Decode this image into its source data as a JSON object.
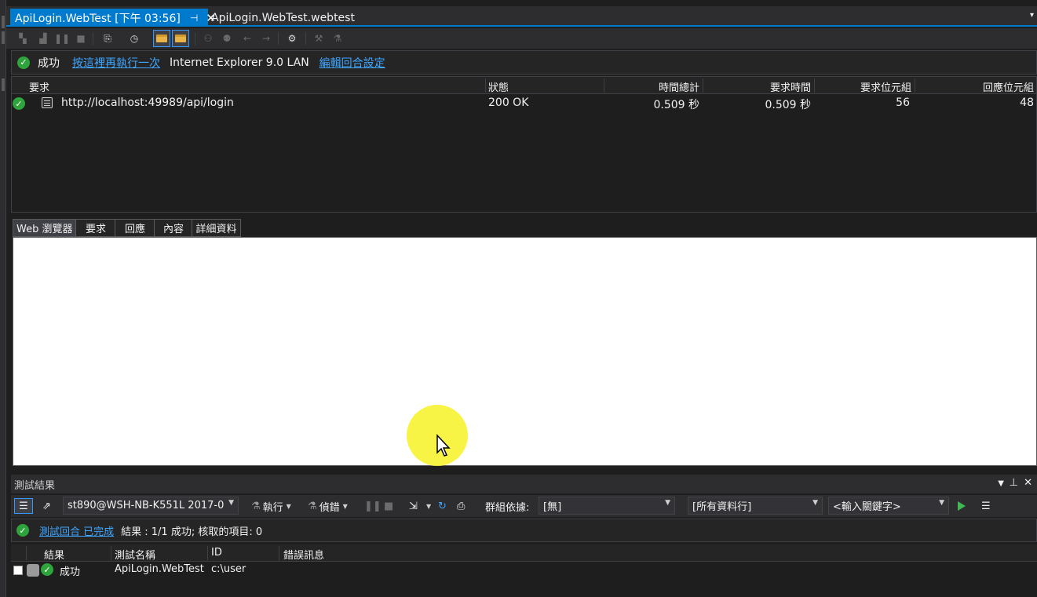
{
  "tabs": {
    "active_label": "ApiLogin.WebTest [下午 03:56]",
    "pin_glyph": "⊣",
    "close_glyph": "✕",
    "second_label": "ApiLogin.WebTest.webtest",
    "overflow_glyph": "▾"
  },
  "status": {
    "result": "成功",
    "rerun_link": "按這裡再執行一次",
    "browser": "Internet Explorer 9.0  LAN",
    "edit_link": "編輯回合設定"
  },
  "requests": {
    "columns": [
      "要求",
      "狀態",
      "時間總計",
      "要求時間",
      "要求位元組",
      "回應位元組"
    ],
    "rows": [
      {
        "url": "http://localhost:49989/api/login",
        "status": "200 OK",
        "total_time": "0.509 秒",
        "request_time": "0.509 秒",
        "request_bytes": "56",
        "response_bytes": "48"
      }
    ]
  },
  "detail_tabs": [
    "Web 瀏覽器",
    "要求",
    "回應",
    "內容",
    "詳細資料"
  ],
  "test_results": {
    "title": "測試結果",
    "run_combo": "st890@WSH-NB-K551L 2017-0",
    "run_label": "執行",
    "debug_label": "偵錯",
    "group_by_label": "群組依據:",
    "group_by_value": "[無]",
    "filter_columns": "[所有資料行]",
    "keyword_placeholder": "<輸入關鍵字>",
    "status_link": "測試回合 已完成",
    "status_summary": "結果 : 1/1 成功;  核取的項目: 0",
    "columns": [
      "結果",
      "測試名稱",
      "ID",
      "錯誤訊息"
    ],
    "rows": [
      {
        "result": "成功",
        "name": "ApiLogin.WebTest",
        "id": "c:\\user"
      }
    ]
  },
  "colors": {
    "accent": "#007acc",
    "success": "#2fa33c",
    "link": "#3ea6ff",
    "background": "#1e1e1e",
    "highlight": "#f7f332"
  }
}
